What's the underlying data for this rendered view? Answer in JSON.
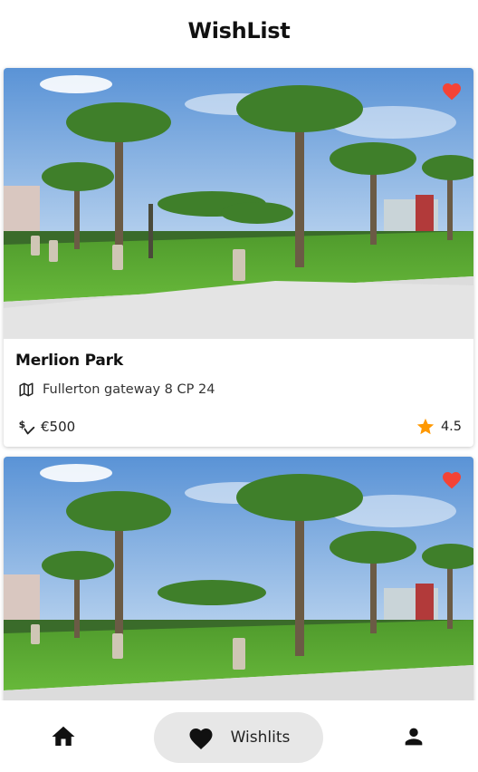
{
  "header": {
    "title": "WishList"
  },
  "colors": {
    "heart": "#f44336",
    "star": "#ff9800",
    "nav_pill": "#e7e7e7"
  },
  "cards": [
    {
      "name": "Merlion Park",
      "address": "Fullerton gateway 8 CP 24",
      "price": "€500",
      "rating": "4.5",
      "favorite_icon": "heart-icon",
      "address_icon": "map-icon",
      "price_icon": "price-change-icon",
      "rating_icon": "star-icon"
    },
    {
      "name": "",
      "favorite_icon": "heart-icon"
    }
  ],
  "bottom_nav": {
    "items": [
      {
        "icon": "home-icon",
        "label": ""
      },
      {
        "icon": "heart-icon",
        "label": "Wishlits",
        "active": true
      },
      {
        "icon": "person-icon",
        "label": ""
      }
    ]
  }
}
